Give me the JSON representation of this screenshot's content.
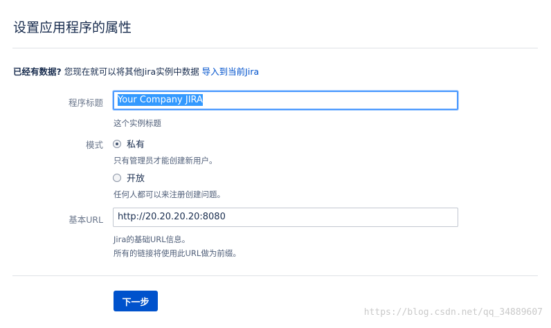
{
  "page": {
    "title": "设置应用程序的属性"
  },
  "import_notice": {
    "strong": "已经有数据?",
    "text": " 您现在就可以将其他Jira实例中数据 ",
    "link": "导入到当前Jira"
  },
  "form": {
    "app_title": {
      "label": "程序标题",
      "value": "Your Company JIRA",
      "help": "这个实例标题"
    },
    "mode": {
      "label": "模式",
      "options": [
        {
          "label": "私有",
          "help": "只有管理员才能创建新用户。",
          "checked": true
        },
        {
          "label": "开放",
          "help": "任何人都可以来注册创建问题。",
          "checked": false
        }
      ]
    },
    "base_url": {
      "label": "基本URL",
      "value": "http://20.20.20.20:8080",
      "help_1": "Jira的基础URL信息。",
      "help_2": "所有的链接将使用此URL做为前缀。"
    }
  },
  "actions": {
    "next_label": "下一步"
  },
  "watermark": "https://blog.csdn.net/qq_34889607",
  "colors": {
    "primary": "#0052cc",
    "focus": "#4c9aff",
    "selection": "#3399ff",
    "text": "#172b4d",
    "muted": "#6b778c"
  }
}
